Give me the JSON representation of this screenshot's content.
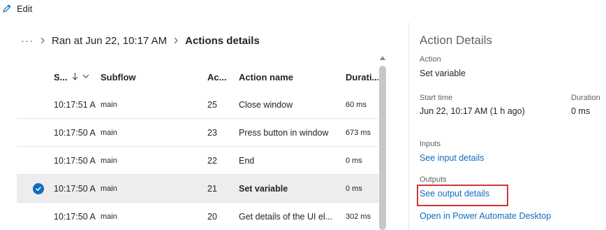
{
  "toolbar": {
    "edit_label": "Edit"
  },
  "breadcrumb": {
    "ellipsis": "···",
    "run": "Ran at Jun 22, 10:17 AM",
    "current": "Actions details"
  },
  "table": {
    "columns": {
      "start": "S...",
      "subflow": "Subflow",
      "action": "Ac...",
      "name": "Action name",
      "duration": "Durati..."
    },
    "rows": [
      {
        "start": "10:17:51 A",
        "subflow": "main",
        "action": "25",
        "name": "Close window",
        "duration": "60 ms",
        "selected": false
      },
      {
        "start": "10:17:50 A",
        "subflow": "main",
        "action": "23",
        "name": "Press button in window",
        "duration": "673 ms",
        "selected": false
      },
      {
        "start": "10:17:50 A",
        "subflow": "main",
        "action": "22",
        "name": "End",
        "duration": "0 ms",
        "selected": false
      },
      {
        "start": "10:17:50 A",
        "subflow": "main",
        "action": "21",
        "name": "Set variable",
        "duration": "0 ms",
        "selected": true
      },
      {
        "start": "10:17:50 A",
        "subflow": "main",
        "action": "20",
        "name": "Get details of the UI el...",
        "duration": "302 ms",
        "selected": false
      }
    ]
  },
  "details": {
    "title": "Action Details",
    "action_label": "Action",
    "action_value": "Set variable",
    "start_label": "Start time",
    "start_value": "Jun 22, 10:17 AM (1 h ago)",
    "duration_label": "Duration",
    "duration_value": "0 ms",
    "inputs_label": "Inputs",
    "inputs_link": "See input details",
    "outputs_label": "Outputs",
    "outputs_link": "See output details",
    "open_link": "Open in Power Automate Desktop"
  },
  "colors": {
    "accent": "#0f6cbd",
    "highlight": "#d13438",
    "selected_row": "#ededed"
  },
  "icons": {
    "edit": "pencil-icon",
    "sort": "arrow-down-icon",
    "selected": "checkmark-circle-icon"
  }
}
